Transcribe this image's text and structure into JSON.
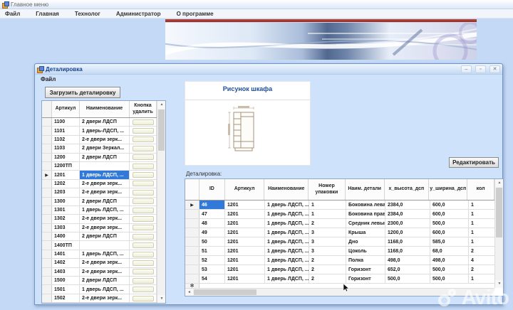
{
  "main_window": {
    "title": "Главное меню",
    "menu_items": [
      {
        "label": "Файл"
      },
      {
        "label": "Главная"
      },
      {
        "label": "Технолог"
      },
      {
        "label": "Администратор"
      },
      {
        "label": "О программе"
      }
    ]
  },
  "child_window": {
    "title": "Деталировка",
    "menu_items": [
      {
        "label": "Файл"
      }
    ],
    "load_button_label": "Загрузить деталировку",
    "edit_button_label": "Редактировать",
    "picture_panel_title": "Рисунок шкафа",
    "details_label": "Деталировка:",
    "window_buttons": {
      "minimize": "–",
      "maximize": "▫",
      "close": "✕"
    }
  },
  "products_grid": {
    "columns": [
      "Артикул",
      "Наименование",
      "Кнопка удалить"
    ],
    "selected_index": 6,
    "rows": [
      {
        "articul": "1100",
        "name": "2 двери ЛДСП"
      },
      {
        "articul": "1101",
        "name": "1 дверь-ЛДСП, ..."
      },
      {
        "articul": "1102",
        "name": "2-е двери зерк..."
      },
      {
        "articul": "1103",
        "name": "2 двери Зеркал..."
      },
      {
        "articul": "1200",
        "name": "2 двери ЛДСП"
      },
      {
        "articul": "1200ТП",
        "name": ""
      },
      {
        "articul": "1201",
        "name": "1 дверь ЛДСП, ..."
      },
      {
        "articul": "1202",
        "name": "2-е двери зерк..."
      },
      {
        "articul": "1203",
        "name": "2-е двери зерк..."
      },
      {
        "articul": "1300",
        "name": "2 двери ЛДСП"
      },
      {
        "articul": "1301",
        "name": "1 дверь ЛДСП, ..."
      },
      {
        "articul": "1302",
        "name": "2-е двери зерк..."
      },
      {
        "articul": "1303",
        "name": "2-е двери зерк..."
      },
      {
        "articul": "1400",
        "name": "2 двери ЛДСП"
      },
      {
        "articul": "1400ТП",
        "name": ""
      },
      {
        "articul": "1401",
        "name": "1 дверь ЛДСП, ..."
      },
      {
        "articul": "1402",
        "name": "2-е двери зерк..."
      },
      {
        "articul": "1403",
        "name": "2-е двери зерк..."
      },
      {
        "articul": "1500",
        "name": "2 двери ЛДСП"
      },
      {
        "articul": "1501",
        "name": "1 дверь ЛДСП, ..."
      },
      {
        "articul": "1502",
        "name": "2-е двери зерк..."
      }
    ]
  },
  "details_grid": {
    "columns": [
      "ID",
      "Артикул",
      "Наименование",
      "Номер упаковки",
      "Наим. детали",
      "х_высота_дсп",
      "у_ширина_дсп",
      "кол"
    ],
    "selected_index": 0,
    "rows": [
      [
        "46",
        "1201",
        "1 дверь ЛДСП, ...",
        "1",
        "Боковина левая",
        "2384,0",
        "600,0",
        "1"
      ],
      [
        "47",
        "1201",
        "1 дверь ЛДСП, ...",
        "1",
        "Боковина прав...",
        "2384,0",
        "600,0",
        "1"
      ],
      [
        "48",
        "1201",
        "1 дверь ЛДСП, ...",
        "2",
        "Средник левый",
        "2300,0",
        "500,0",
        "1"
      ],
      [
        "49",
        "1201",
        "1 дверь ЛДСП, ...",
        "3",
        "Крыша",
        "1200,0",
        "600,0",
        "1"
      ],
      [
        "50",
        "1201",
        "1 дверь ЛДСП, ...",
        "3",
        "Дно",
        "1168,0",
        "585,0",
        "1"
      ],
      [
        "51",
        "1201",
        "1 дверь ЛДСП, ...",
        "3",
        "Цоколь",
        "1168,0",
        "68,0",
        "2"
      ],
      [
        "52",
        "1201",
        "1 дверь ЛДСП, ...",
        "2",
        "Полка",
        "498,0",
        "498,0",
        "4"
      ],
      [
        "53",
        "1201",
        "1 дверь ЛДСП, ...",
        "2",
        "Горизонт",
        "652,0",
        "500,0",
        "2"
      ],
      [
        "54",
        "1201",
        "1 дверь ЛДСП, ...",
        "2",
        "Горизонт",
        "500,0",
        "500,0",
        "1"
      ]
    ]
  },
  "icons": {
    "arrow_up": "▲",
    "arrow_down": "▼",
    "arrow_left": "◄",
    "row_marker": "▶",
    "new_row": "✻"
  },
  "watermark": {
    "text": "Avito"
  },
  "colors": {
    "accent_red": "#ac3024",
    "selection_blue": "#3179d8",
    "desktop_blue": "#c3d9f6",
    "window_blue": "#cfe2fb",
    "title_text": "#15428b"
  }
}
